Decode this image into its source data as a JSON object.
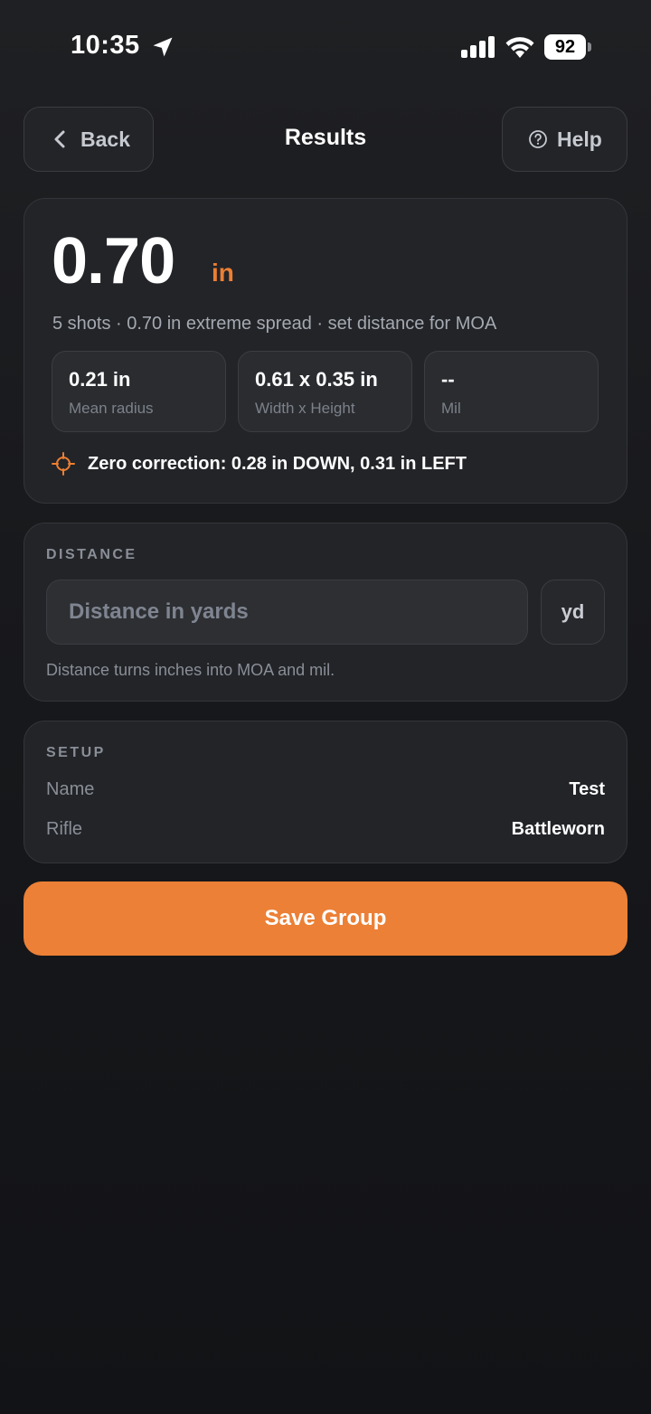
{
  "status_bar": {
    "time": "10:35",
    "battery": "92"
  },
  "header": {
    "back_label": "Back",
    "title": "Results",
    "help_label": "Help"
  },
  "result": {
    "value": "0.70",
    "unit": "in",
    "summary": "5 shots · 0.70 in extreme spread · set distance for MOA",
    "stats": [
      {
        "value": "0.21 in",
        "label": "Mean radius"
      },
      {
        "value": "0.61 x 0.35 in",
        "label": "Width x Height"
      },
      {
        "value": "--",
        "label": "Mil"
      }
    ],
    "zero_correction": "Zero correction: 0.28 in DOWN, 0.31 in LEFT"
  },
  "distance": {
    "section_label": "DISTANCE",
    "placeholder": "Distance in yards",
    "value": "",
    "unit": "yd",
    "help_text": "Distance turns inches into MOA and mil."
  },
  "setup": {
    "section_label": "SETUP",
    "rows": [
      {
        "key": "Name",
        "value": "Test"
      },
      {
        "key": "Rifle",
        "value": "Battleworn"
      }
    ]
  },
  "save_label": "Save Group",
  "colors": {
    "accent": "#ec8036",
    "background": "#18191c",
    "card": "#222428"
  }
}
